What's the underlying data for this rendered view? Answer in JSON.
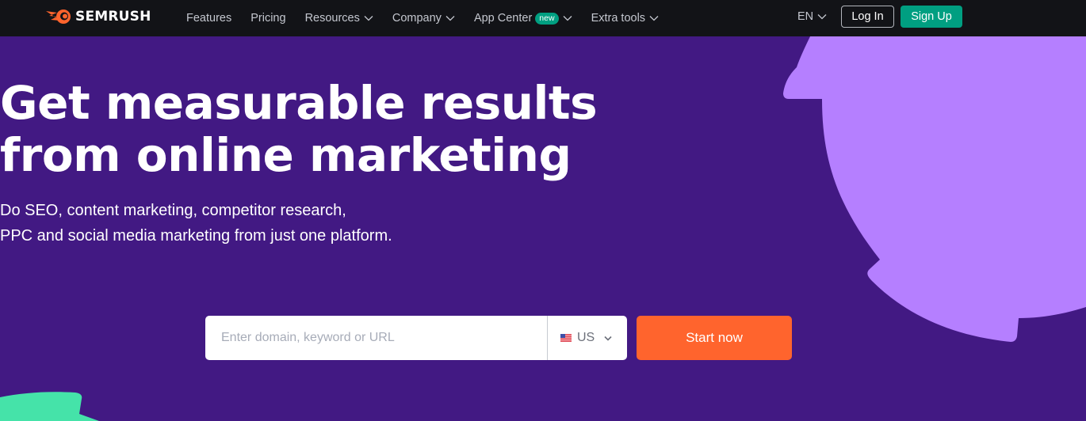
{
  "brand": {
    "name": "SEMRUSH",
    "accent": "#ff642d",
    "green": "#009f81",
    "bg": "#421983",
    "decor_purple": "#b57fff",
    "decor_green": "#45e3a9"
  },
  "nav": {
    "items": [
      {
        "label": "Features",
        "dropdown": false
      },
      {
        "label": "Pricing",
        "dropdown": false
      },
      {
        "label": "Resources",
        "dropdown": true
      },
      {
        "label": "Company",
        "dropdown": true
      },
      {
        "label": "App Center",
        "dropdown": true,
        "badge": "new"
      },
      {
        "label": "Extra tools",
        "dropdown": true
      }
    ],
    "language": "EN",
    "login": "Log In",
    "signup": "Sign Up"
  },
  "hero": {
    "title_line1": "Get measurable results",
    "title_line2": "from online marketing",
    "subtitle_line1": "Do SEO, content marketing, competitor research,",
    "subtitle_line2": "PPC and social media marketing from just one platform."
  },
  "search": {
    "placeholder": "Enter domain, keyword or URL",
    "value": "",
    "country": "US",
    "submit": "Start now"
  }
}
